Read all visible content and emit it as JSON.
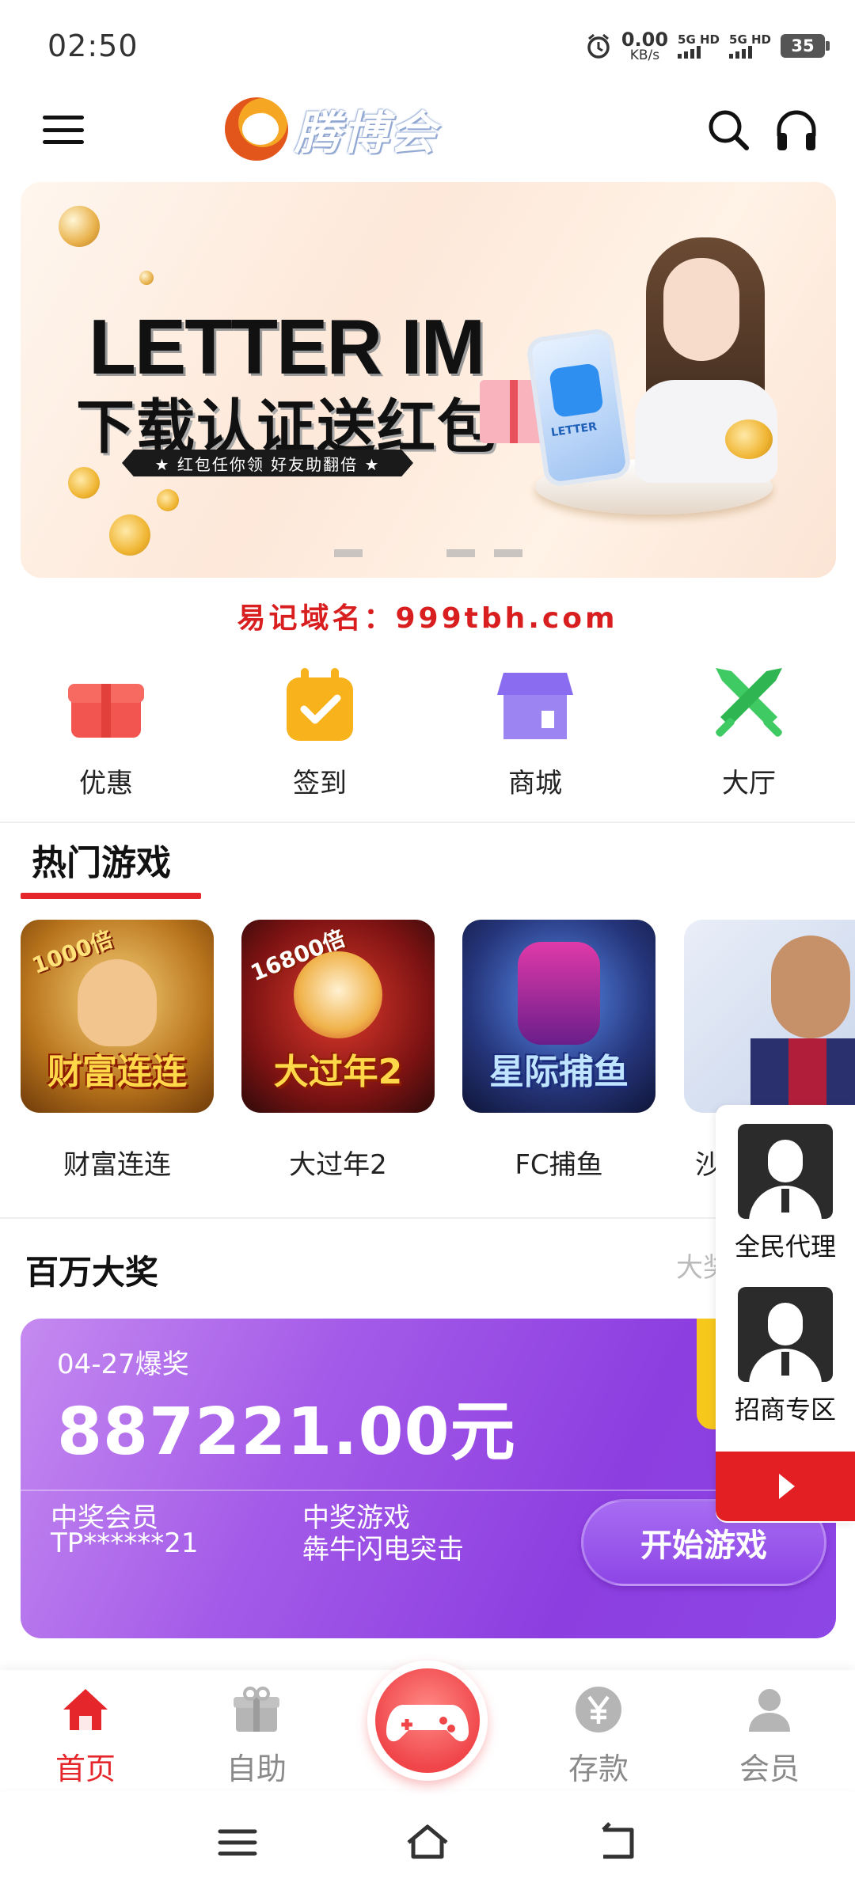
{
  "status_bar": {
    "time": "02:50",
    "net_speed": "0.00",
    "net_unit": "KB/s",
    "sim1": "5G HD",
    "sim2": "5G HD",
    "battery": "35"
  },
  "header": {
    "logo_text": "腾博会",
    "icons": [
      "menu-icon",
      "search-icon",
      "headset-icon"
    ]
  },
  "banner": {
    "title": "LETTER IM",
    "subtitle": "下载认证送红包",
    "ribbon": "★ 红包任你领 好友助翻倍 ★",
    "phone_label": "LETTER"
  },
  "domain_notice": "易记域名：999tbh.com",
  "quick_nav": [
    {
      "label": "优惠",
      "icon": "gift-icon",
      "color": "#f2554f"
    },
    {
      "label": "签到",
      "icon": "calendar-check-icon",
      "color": "#f8b21c"
    },
    {
      "label": "商城",
      "icon": "store-icon",
      "color": "#8a6cf0"
    },
    {
      "label": "大厅",
      "icon": "crossed-swords-icon",
      "color": "#3fca63"
    }
  ],
  "hot_games": {
    "title": "热门游戏",
    "items": [
      {
        "name": "财富连连",
        "thumb_text": "财富连连",
        "badge": "1000倍"
      },
      {
        "name": "大过年2",
        "thumb_text": "大过年2",
        "badge": "16800倍"
      },
      {
        "name": "FC捕鱼",
        "thumb_text": "星际捕鱼",
        "badge": ""
      },
      {
        "name": "沙",
        "thumb_text": "",
        "badge": ""
      }
    ]
  },
  "side_float": {
    "items": [
      {
        "label": "全民代理"
      },
      {
        "label": "招商专区"
      }
    ]
  },
  "jackpot": {
    "title": "百万大奖",
    "more_text": "大奖",
    "date_label": "04-27爆奖",
    "amount": "887221.00元",
    "member_label": "中奖会员",
    "member_value": "TP******21",
    "game_label": "中奖游戏",
    "game_value": "犇牛闪电突击",
    "button": "开始游戏"
  },
  "tab_bar": {
    "items": [
      {
        "label": "首页",
        "icon": "home-icon",
        "active": true
      },
      {
        "label": "自助",
        "icon": "gift-box-icon",
        "active": false
      },
      {
        "label": "存款",
        "icon": "yen-coin-icon",
        "active": false
      },
      {
        "label": "会员",
        "icon": "person-icon",
        "active": false
      }
    ],
    "center_icon": "gamepad-icon"
  },
  "colors": {
    "accent": "#e5262a",
    "jackpot_start": "#c58af0",
    "jackpot_end": "#8d46e6"
  }
}
